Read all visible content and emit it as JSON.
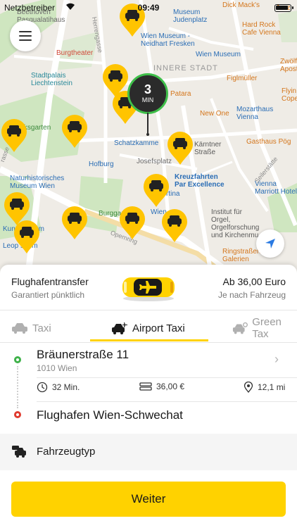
{
  "status_bar": {
    "carrier": "Netzbetreiber",
    "time": "09:49"
  },
  "map": {
    "labels": {
      "beethoven": "Beethoven\nPasqualatihaus",
      "burgtheater": "Burgtheater",
      "stadtpalais": "Stadtpalais\nLiechtenstein",
      "volksgarten": "Volksgarten",
      "naturhist": "Naturhistorisches\nMuseum Wien",
      "kunsthist": "Kun      museum",
      "leopold": "Leop      seum",
      "hofburg": "Hofburg",
      "burggart": "Burggart",
      "schatzkammer": "Schatzkamme",
      "josefsplatz": "Josefsplatz",
      "museum_juden": "Museum\nJudenplatz",
      "wien_museum": "Wien Museum -\nNeidhart Fresken",
      "wien_museum2": "Wien Museum",
      "innere": "INNERE STADT",
      "patara": "Patara",
      "newone": "New One",
      "figlmueller": "Figlmüller",
      "mozart": "Mozarthaus\nVienna",
      "gasthaus": "Gasthaus Pög",
      "kaerntner": "Kärntner\nStraße",
      "kreuzfahrten": "Kreuzfahrten\nPar Excellence",
      "albertina": "rtina",
      "wien_lbl": "Wien",
      "institut": "Institut für\nOrgel,\nOrgelforschung\nund Kirchenmu",
      "ringstrassen": "Ringstraßen-\nGalerien",
      "marriott": "Vienna\nMarriott Hotel",
      "hardrock": "Hard Rock\nCafe Vienna",
      "dickmacks": "Dick Mack's",
      "jazz": "Jazz",
      "zwoelf": "Zwölf\nApost",
      "flying": "Flyin\nCope",
      "herrengasse": "Herrengasse",
      "opernring": "Opernring",
      "seilerstaette": "Seilerstätte",
      "strasse": "rasse"
    },
    "eta": {
      "value": "3",
      "unit": "MIN"
    }
  },
  "fare": {
    "title": "Flughafentransfer",
    "subtitle": "Garantiert pünktlich",
    "price": "Ab 36,00 Euro",
    "price_note": "Je nach Fahrzeug"
  },
  "tabs": [
    {
      "label": "Taxi",
      "active": false
    },
    {
      "label": "Airport Taxi",
      "active": true
    },
    {
      "label": "Green Tax",
      "active": false
    }
  ],
  "route": {
    "origin": "Bräunerstraße 11",
    "origin_city": "1010 Wien",
    "duration": "32 Min.",
    "cost": "36,00 €",
    "distance": "12,1 mi",
    "destination": "Flughafen Wien-Schwechat"
  },
  "vehicle": {
    "label": "Fahrzeugtyp"
  },
  "continue_button": {
    "label": "Weiter"
  },
  "colors": {
    "accent": "#ffd200",
    "eta_ring": "#3fbf4a",
    "origin": "#3fb24a",
    "destination": "#e03a2e"
  },
  "icons": [
    "menu-icon",
    "wifi-icon",
    "battery-icon",
    "locate-icon",
    "taxi-icon",
    "airplane-icon",
    "clock-icon",
    "money-icon",
    "pin-icon",
    "chevron-right-icon",
    "vehicle-icon"
  ]
}
